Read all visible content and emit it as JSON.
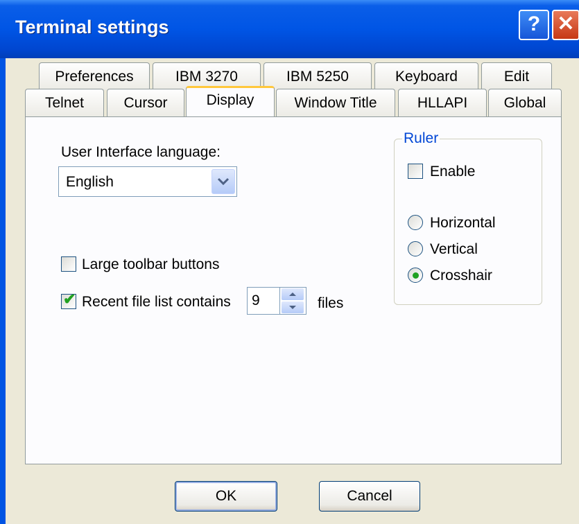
{
  "window": {
    "title": "Terminal settings"
  },
  "titlebar": {
    "help_label": "?",
    "close_label": "✕"
  },
  "tabs": {
    "row1": [
      "Preferences",
      "IBM 3270",
      "IBM 5250",
      "Keyboard",
      "Edit"
    ],
    "row2": [
      "Telnet",
      "Cursor",
      "Display",
      "Window Title",
      "HLLAPI",
      "Global"
    ],
    "active": "Display"
  },
  "display": {
    "ui_language_label": "User Interface language:",
    "ui_language_value": "English",
    "large_toolbar_label": "Large toolbar buttons",
    "large_toolbar_checked": false,
    "recent_files_label": "Recent file list contains",
    "recent_files_checked": true,
    "recent_files_count": "9",
    "recent_files_suffix": "files"
  },
  "ruler": {
    "title": "Ruler",
    "enable_label": "Enable",
    "enable_checked": false,
    "options": [
      "Horizontal",
      "Vertical",
      "Crosshair"
    ],
    "selected": "Crosshair"
  },
  "buttons": {
    "ok": "OK",
    "cancel": "Cancel"
  },
  "colors": {
    "title_bar": "#0055e5",
    "accent_check": "#21a121",
    "group_title": "#0046d5"
  }
}
